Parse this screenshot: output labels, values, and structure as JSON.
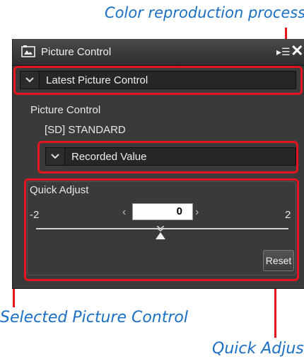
{
  "callouts": {
    "top": "Color reproduction process",
    "selected": "Selected Picture Control",
    "quick": "Quick Adjus"
  },
  "panel": {
    "title": "Picture Control",
    "title_icon": "picture-control-icon",
    "menu_icon": "menu-list-icon",
    "close_icon": "close-icon",
    "process_dropdown": "Latest Picture Control",
    "picture_control_label": "Picture Control",
    "picture_control_value": "[SD] STANDARD",
    "selected_dropdown": "Recorded Value",
    "quick_adjust": {
      "label": "Quick Adjust",
      "min": "-2",
      "max": "2",
      "value": "0",
      "slider_value": 0,
      "reset_label": "Reset"
    }
  },
  "colors": {
    "callout_text": "#1a6fc4",
    "highlight": "#e4151f",
    "panel_bg": "#3a3a3a"
  }
}
